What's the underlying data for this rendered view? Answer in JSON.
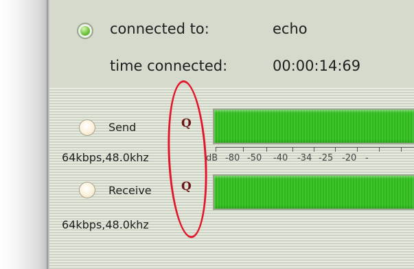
{
  "connection": {
    "connected_label": "connected to:",
    "connected_value": "echo",
    "time_label": "time connected:",
    "time_value": "00:00:14:69"
  },
  "send": {
    "label": "Send",
    "rate": "64kbps,48.0khz",
    "quality_button": "Q"
  },
  "receive": {
    "label": "Receive",
    "rate": "64kbps,48.0khz",
    "quality_button": "Q"
  },
  "scale": {
    "ticks": [
      "dB",
      "-80",
      "-50",
      "-40",
      "-34",
      "-25",
      "-20",
      "-"
    ]
  },
  "colors": {
    "meter_green": "#3fc62b",
    "status_indicator": "#6cc23a",
    "annotation_red": "#e3152a",
    "quality_icon": "#6b1414"
  }
}
